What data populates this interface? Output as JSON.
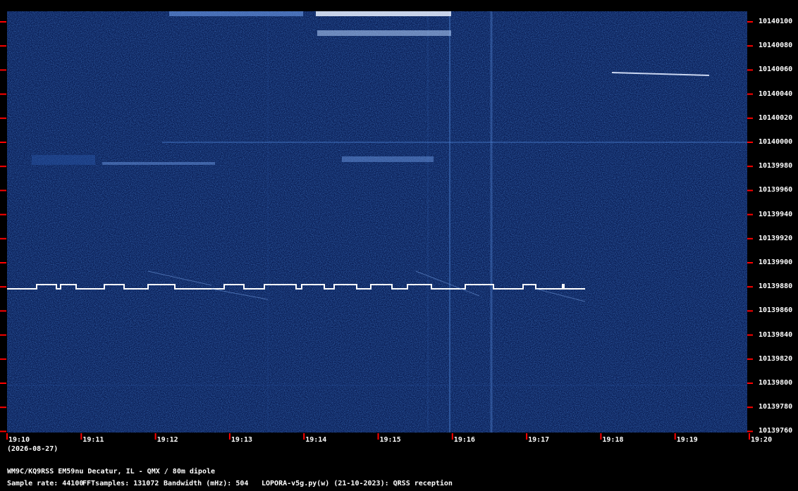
{
  "window": {
    "date": "(2026-08-27)"
  },
  "freq_labels": [
    "10140100",
    "10140080",
    "10140060",
    "10140040",
    "10140020",
    "10140000",
    "10139980",
    "10139960",
    "10139940",
    "10139920",
    "10139900",
    "10139880",
    "10139860",
    "10139840",
    "10139820",
    "10139800",
    "10139780",
    "10139760"
  ],
  "time_labels": [
    "19:10",
    "19:11",
    "19:12",
    "19:13",
    "19:14",
    "19:15",
    "19:16",
    "19:17",
    "19:18",
    "19:19",
    "19:20"
  ],
  "footer": {
    "station": "WM9C/KQ9RSS EM59nu Decatur, IL - QMX / 80m dipole",
    "sample_rate": "Sample rate: 44100",
    "fft_samples": "FFTsamples: 131072",
    "bandwidth": "Bandwidth (mHz): 504",
    "software": "LOPORA-v5g.py(w) (21-10-2023): QRSS reception"
  },
  "colors": {
    "background": "#000000",
    "waterfall": "#0a1e55",
    "tick": "#ff0000",
    "signal": "#ffffff"
  }
}
